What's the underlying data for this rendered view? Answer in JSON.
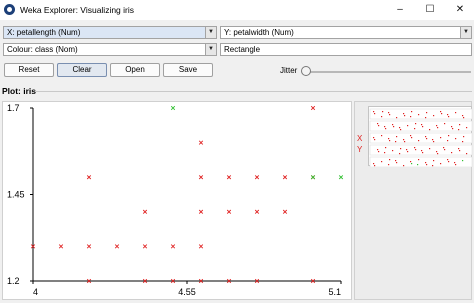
{
  "window": {
    "title": "Weka Explorer: Visualizing iris",
    "minimize": "–",
    "maximize": "☐",
    "close": "✕"
  },
  "controls": {
    "x_axis": "X: petallength (Num)",
    "y_axis": "Y: petalwidth (Num)",
    "colour": "Colour: class (Nom)",
    "shape": "Rectangle",
    "reset": "Reset",
    "clear": "Clear",
    "open": "Open",
    "save": "Save",
    "jitter_label": "Jitter",
    "jitter_value": 0
  },
  "plot": {
    "section_title": "Plot: iris"
  },
  "colors": {
    "class_a": "#e02020",
    "class_b": "#30c030"
  },
  "chart_data": {
    "type": "scatter",
    "xlim": [
      4,
      5.1
    ],
    "ylim": [
      1.2,
      1.7
    ],
    "x_ticks": [
      "4",
      "4.55",
      "5.1"
    ],
    "y_ticks": [
      "1.7",
      "1.45",
      "1.2"
    ],
    "grid": false,
    "legend": "none",
    "marker": "x",
    "series": [
      {
        "color": "#e02020",
        "points": [
          [
            4.0,
            1.3
          ],
          [
            4.1,
            1.3
          ],
          [
            4.2,
            1.3
          ],
          [
            4.3,
            1.3
          ],
          [
            4.4,
            1.3
          ],
          [
            4.5,
            1.3
          ],
          [
            4.6,
            1.3
          ],
          [
            4.2,
            1.5
          ],
          [
            4.6,
            1.6
          ],
          [
            4.6,
            1.5
          ],
          [
            4.7,
            1.5
          ],
          [
            4.8,
            1.5
          ],
          [
            4.9,
            1.5
          ],
          [
            5.0,
            1.5
          ],
          [
            5.0,
            1.7
          ],
          [
            4.4,
            1.4
          ],
          [
            4.6,
            1.4
          ],
          [
            4.7,
            1.4
          ],
          [
            4.8,
            1.4
          ],
          [
            4.9,
            1.4
          ],
          [
            4.2,
            1.2
          ],
          [
            4.4,
            1.2
          ],
          [
            4.5,
            1.2
          ],
          [
            4.6,
            1.2
          ],
          [
            4.7,
            1.2
          ],
          [
            4.8,
            1.2
          ],
          [
            5.0,
            1.2
          ]
        ]
      },
      {
        "color": "#30c030",
        "points": [
          [
            4.5,
            1.7
          ],
          [
            5.0,
            1.5
          ],
          [
            5.1,
            1.5
          ]
        ]
      }
    ]
  }
}
